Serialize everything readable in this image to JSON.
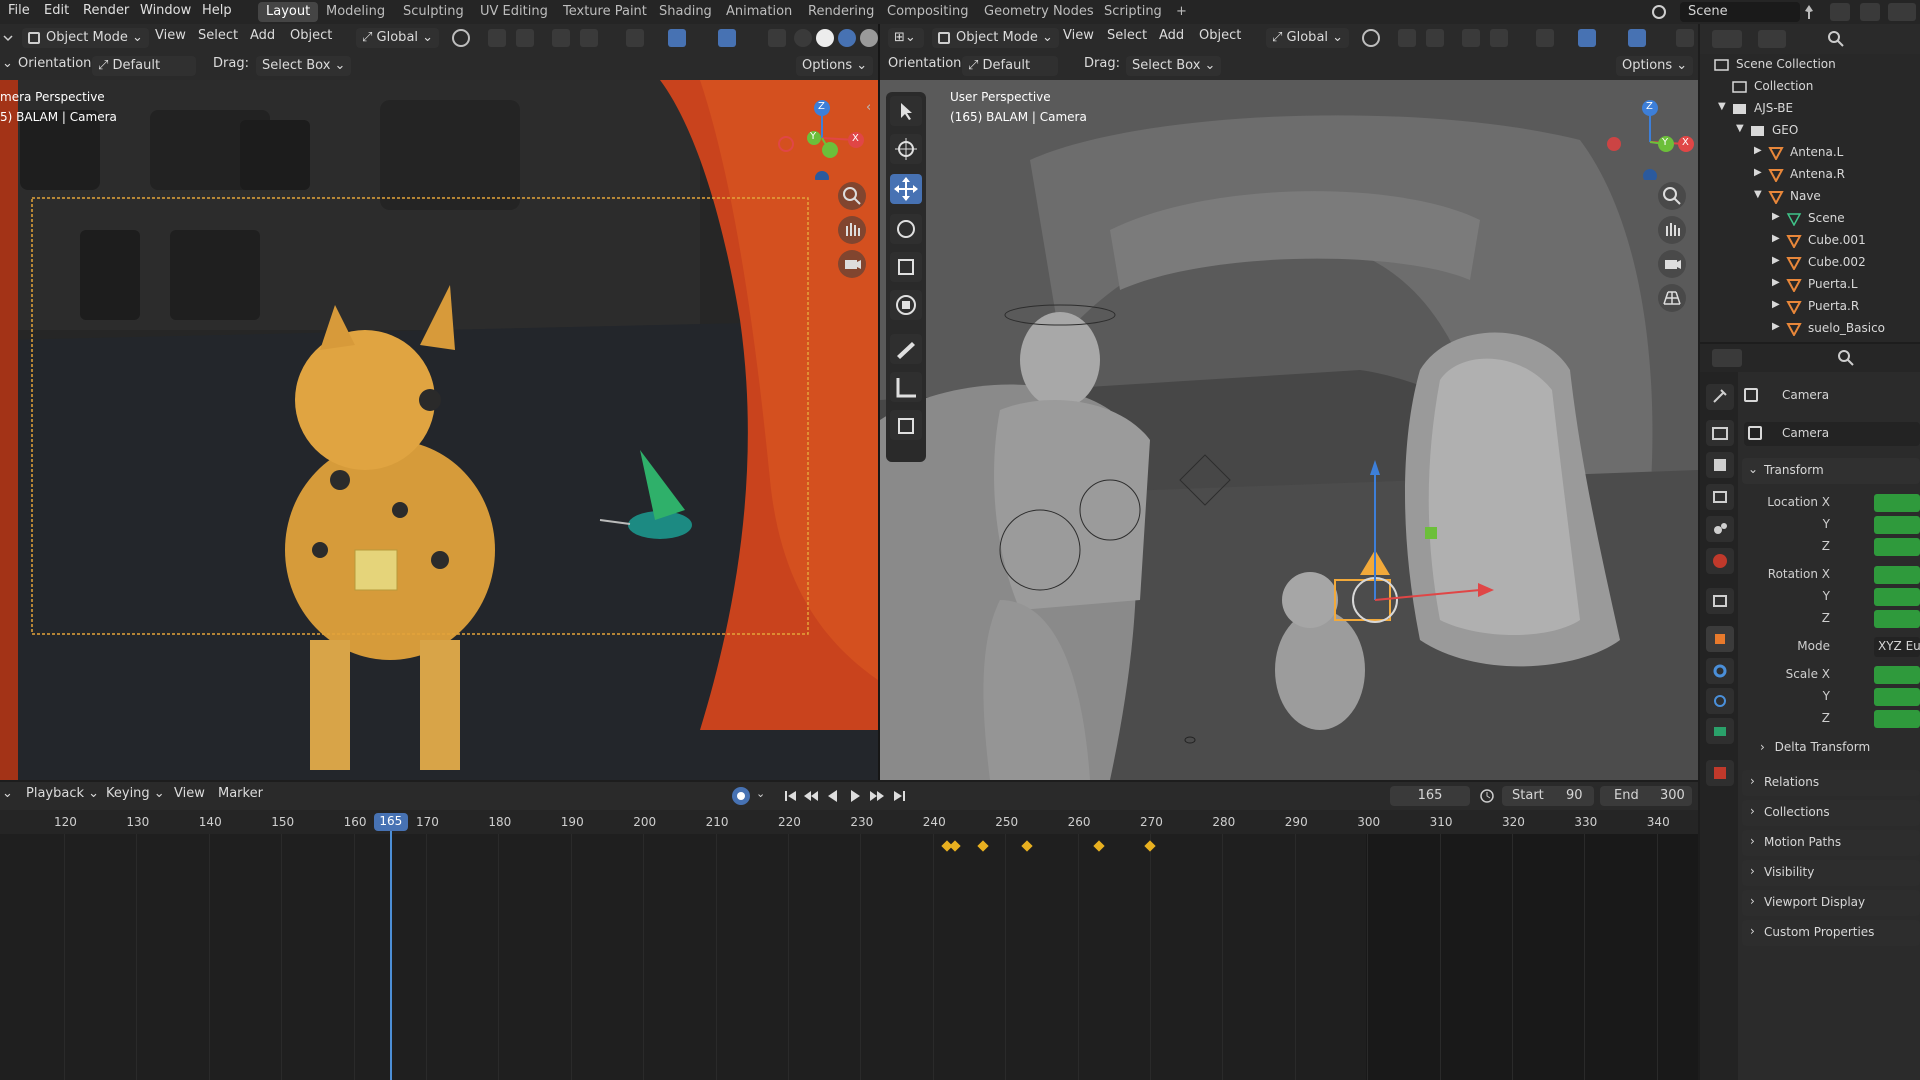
{
  "menus": [
    "File",
    "Edit",
    "Render",
    "Window",
    "Help"
  ],
  "workspace_tabs": [
    "Layout",
    "Modeling",
    "Sculpting",
    "UV Editing",
    "Texture Paint",
    "Shading",
    "Animation",
    "Rendering",
    "Compositing",
    "Geometry Nodes",
    "Scripting",
    "+"
  ],
  "active_workspace": "Layout",
  "scene_name": "Scene",
  "viewport_left": {
    "mode": "Object Mode",
    "menus": [
      "View",
      "Select",
      "Add",
      "Object"
    ],
    "transform": "Global",
    "orientation_label": "Orientation:",
    "orientation_value": "Default",
    "drag_label": "Drag:",
    "drag_value": "Select Box",
    "options": "Options",
    "title": "mera Perspective",
    "subtitle": "5) BALAM | Camera"
  },
  "viewport_right": {
    "mode": "Object Mode",
    "menus": [
      "View",
      "Select",
      "Add",
      "Object"
    ],
    "transform": "Global",
    "orientation_label": "Orientation:",
    "orientation_value": "Default",
    "drag_label": "Drag:",
    "drag_value": "Select Box",
    "options": "Options",
    "title": "User Perspective",
    "subtitle": "(165) BALAM | Camera"
  },
  "gizmo": {
    "x": "X",
    "y": "Y",
    "z": "Z"
  },
  "outliner": {
    "rows": [
      {
        "label": "Scene Collection",
        "indent": 0
      },
      {
        "label": "Collection",
        "indent": 1
      },
      {
        "label": "AJS-BE",
        "indent": 1
      },
      {
        "label": "GEO",
        "indent": 2
      },
      {
        "label": "Antena.L",
        "indent": 3
      },
      {
        "label": "Antena.R",
        "indent": 3
      },
      {
        "label": "Nave",
        "indent": 3
      },
      {
        "label": "Scene",
        "indent": 4
      },
      {
        "label": "Cube.001",
        "indent": 4
      },
      {
        "label": "Cube.002",
        "indent": 4
      },
      {
        "label": "Puerta.L",
        "indent": 4
      },
      {
        "label": "Puerta.R",
        "indent": 4
      },
      {
        "label": "suelo_Basico",
        "indent": 4
      }
    ]
  },
  "properties": {
    "object_name": "Camera",
    "data_name": "Camera",
    "transform": "Transform",
    "location_x": "Location X",
    "y": "Y",
    "z": "Z",
    "rotation_x": "Rotation X",
    "mode_label": "Mode",
    "mode_value": "XYZ Eu",
    "scale_x": "Scale X",
    "delta_transform": "Delta Transform",
    "panels": [
      "Relations",
      "Collections",
      "Motion Paths",
      "Visibility",
      "Viewport Display",
      "Custom Properties"
    ]
  },
  "timeline": {
    "menus": [
      "Playback",
      "Keying",
      "View",
      "Marker"
    ],
    "current_frame": "165",
    "start_label": "Start",
    "start_value": "90",
    "end_label": "End",
    "end_value": "300",
    "ticks": [
      "120",
      "130",
      "140",
      "150",
      "160",
      "165",
      "170",
      "180",
      "190",
      "200",
      "210",
      "220",
      "230",
      "240",
      "250",
      "260",
      "270",
      "280",
      "290",
      "300",
      "310",
      "320",
      "330",
      "340"
    ],
    "keyframes": [
      242,
      243,
      247,
      253,
      263,
      270
    ]
  },
  "colors": {
    "accent": "#4772b3",
    "keyframe": "#e8b020",
    "playhead": "#4d8fd6",
    "field_green": "#2f9a3c"
  }
}
